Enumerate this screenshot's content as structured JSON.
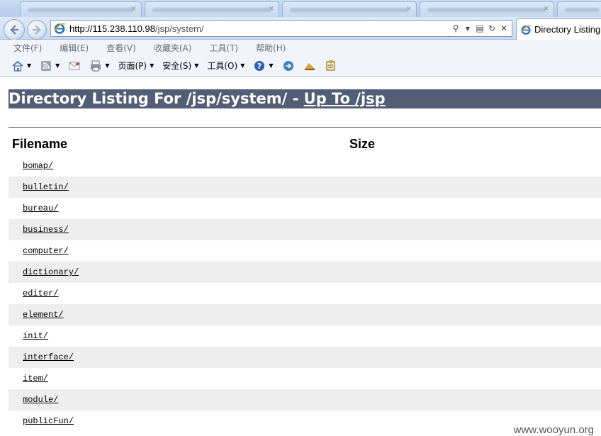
{
  "browser": {
    "address": {
      "url_host": "http://115.238.110.98",
      "url_path": "/jsp/system/"
    },
    "active_tab": {
      "title": "Directory Listing"
    },
    "menu": [
      {
        "label": "文件(F)"
      },
      {
        "label": "编辑(E)"
      },
      {
        "label": "查看(V)"
      },
      {
        "label": "收藏夹(A)"
      },
      {
        "label": "工具(T)"
      },
      {
        "label": "帮助(H)"
      }
    ],
    "command_bar": {
      "page_label": "页面(P)",
      "safety_label": "安全(S)",
      "tools_label": "工具(O)"
    }
  },
  "listing": {
    "heading_prefix": "Directory Listing For /jsp/system/ - ",
    "heading_link": "Up To /jsp",
    "col_filename": "Filename",
    "col_size": "Size",
    "rows": [
      {
        "name": "bomap/"
      },
      {
        "name": "bulletin/"
      },
      {
        "name": "bureau/"
      },
      {
        "name": "business/"
      },
      {
        "name": "computer/"
      },
      {
        "name": "dictionary/"
      },
      {
        "name": "editer/"
      },
      {
        "name": "element/"
      },
      {
        "name": "init/"
      },
      {
        "name": "interface/"
      },
      {
        "name": "item/"
      },
      {
        "name": "module/"
      },
      {
        "name": "publicFun/"
      }
    ]
  },
  "watermark": "www.wooyun.org",
  "colors": {
    "heading_bg": "#525d76",
    "alt_row_bg": "#eeeeee"
  }
}
